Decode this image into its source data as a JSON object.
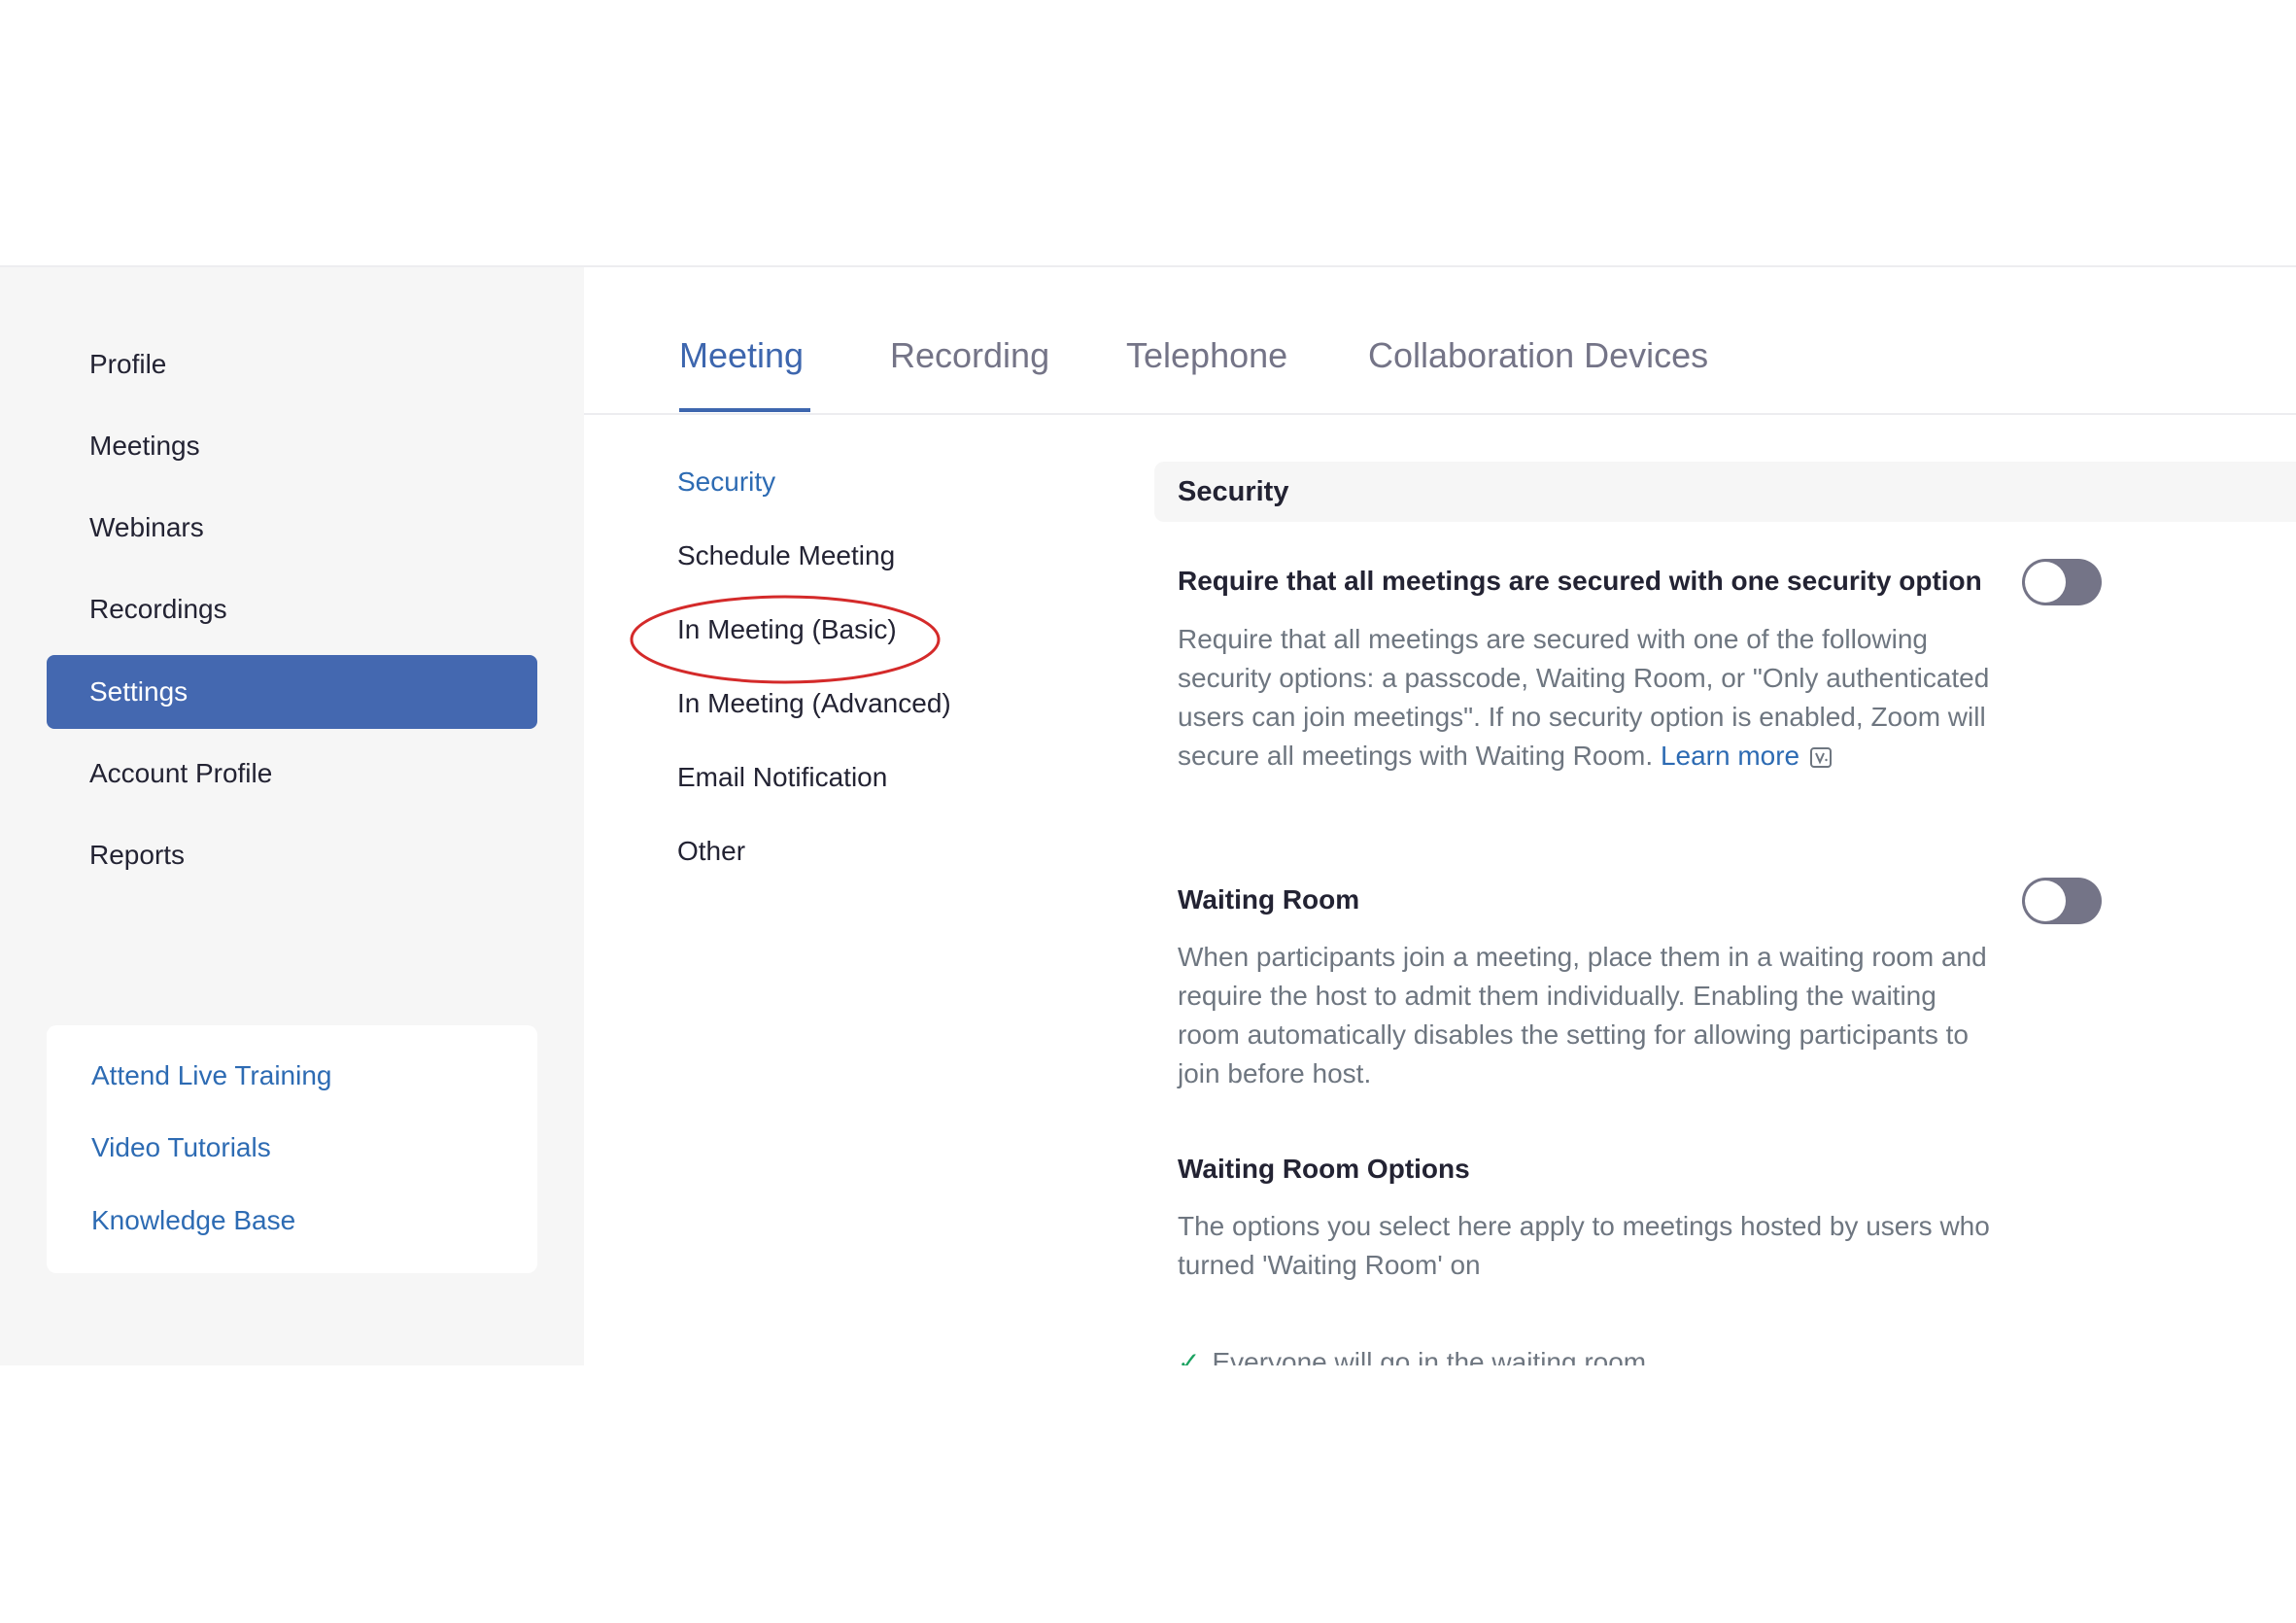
{
  "sidebar": {
    "items": [
      {
        "label": "Profile"
      },
      {
        "label": "Meetings"
      },
      {
        "label": "Webinars"
      },
      {
        "label": "Recordings"
      },
      {
        "label": "Settings",
        "active": true
      },
      {
        "label": "Account Profile"
      },
      {
        "label": "Reports"
      }
    ],
    "help_links": [
      {
        "label": "Attend Live Training"
      },
      {
        "label": "Video Tutorials"
      },
      {
        "label": "Knowledge Base"
      }
    ]
  },
  "tabs": [
    {
      "label": "Meeting",
      "active": true
    },
    {
      "label": "Recording"
    },
    {
      "label": "Telephone"
    },
    {
      "label": "Collaboration Devices"
    }
  ],
  "subnav": [
    {
      "label": "Security",
      "active": true
    },
    {
      "label": "Schedule Meeting"
    },
    {
      "label": "In Meeting (Basic)",
      "highlighted": true
    },
    {
      "label": "In Meeting (Advanced)"
    },
    {
      "label": "Email Notification"
    },
    {
      "label": "Other"
    }
  ],
  "content": {
    "section_title": "Security",
    "settings": [
      {
        "title": "Require that all meetings are secured with one security option",
        "description": "Require that all meetings are secured with one of the following security options: a passcode, Waiting Room, or \"Only authenticated users can join meetings\". If no security option is enabled, Zoom will secure all meetings with Waiting Room.",
        "link": "Learn more",
        "enabled": false
      },
      {
        "title": "Waiting Room",
        "description": "When participants join a meeting, place them in a waiting room and require the host to admit them individually. Enabling the waiting room automatically disables the setting for allowing participants to join before host.",
        "enabled": false
      }
    ],
    "options": {
      "title": "Waiting Room Options",
      "description": "The options you select here apply to meetings hosted by users who turned 'Waiting Room' on",
      "check_item": "Everyone will go in the waiting room"
    }
  },
  "colors": {
    "accent": "#4468b0",
    "link": "#2d6bb3",
    "highlight_ellipse": "#d42a2a",
    "toggle_off": "#747487",
    "sidebar_bg": "#f6f6f6"
  }
}
